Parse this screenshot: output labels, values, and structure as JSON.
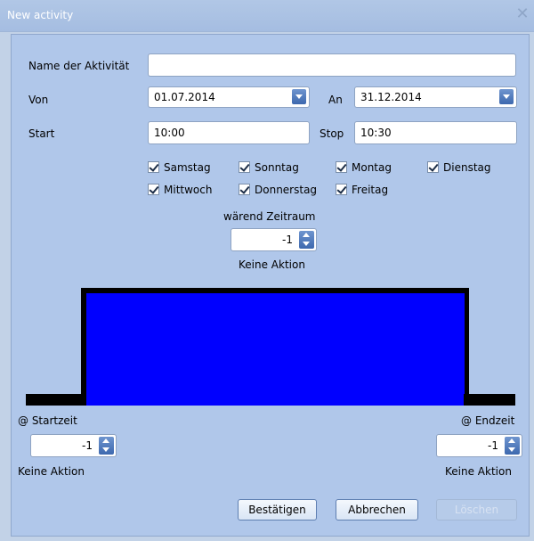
{
  "window": {
    "title": "New activity",
    "close_glyph": "✕"
  },
  "form": {
    "name_label": "Name der Aktivität",
    "name_value": "",
    "von_label": "Von",
    "von_value": "01.07.2014",
    "an_label": "An",
    "an_value": "31.12.2014",
    "start_label": "Start",
    "start_value": "10:00",
    "stop_label": "Stop",
    "stop_value": "10:30"
  },
  "days": [
    {
      "label": "Samstag",
      "checked": true
    },
    {
      "label": "Sonntag",
      "checked": true
    },
    {
      "label": "Montag",
      "checked": true
    },
    {
      "label": "Dienstag",
      "checked": true
    },
    {
      "label": "Mittwoch",
      "checked": true
    },
    {
      "label": "Donnerstag",
      "checked": true
    },
    {
      "label": "Freitag",
      "checked": true
    }
  ],
  "during": {
    "label": "wärend Zeitraum",
    "value": "-1",
    "action": "Keine Aktion"
  },
  "start_time": {
    "label": "@ Startzeit",
    "value": "-1",
    "action": "Keine Aktion"
  },
  "end_time": {
    "label": "@ Endzeit",
    "value": "-1",
    "action": "Keine Aktion"
  },
  "buttons": {
    "confirm": "Bestätigen",
    "cancel": "Abbrechen",
    "delete": "Löschen"
  },
  "colors": {
    "active_fill": "#0000ff",
    "outline": "#000000",
    "accent": "#3d68ae"
  }
}
